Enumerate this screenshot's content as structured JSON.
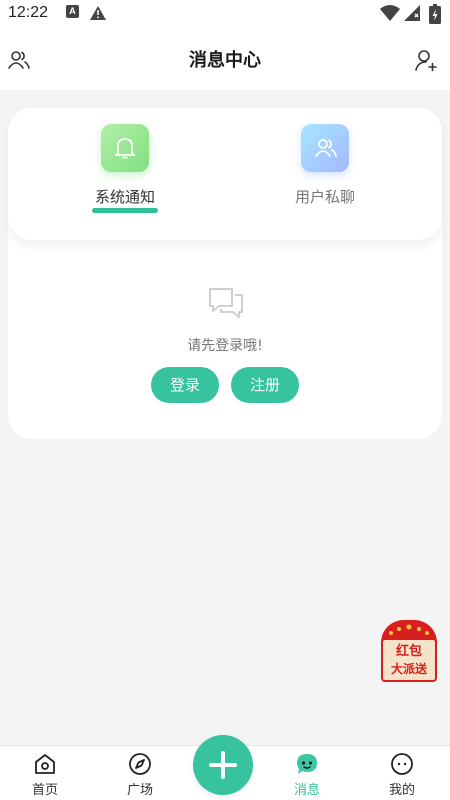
{
  "status_bar": {
    "time": "12:22",
    "a_badge": "A"
  },
  "header": {
    "title": "消息中心"
  },
  "tabs": [
    {
      "label": "系统通知",
      "active": true
    },
    {
      "label": "用户私聊",
      "active": false
    }
  ],
  "empty_state": {
    "text": "请先登录哦!"
  },
  "buttons": {
    "login": "登录",
    "register": "注册"
  },
  "red_packet": {
    "line1": "红包",
    "line2": "大派送"
  },
  "bottom_nav": {
    "items": [
      {
        "label": "首页",
        "icon": "home-icon"
      },
      {
        "label": "广场",
        "icon": "compass-icon"
      },
      {
        "label": "消息",
        "icon": "message-icon",
        "active": true
      },
      {
        "label": "我的",
        "icon": "profile-icon"
      }
    ],
    "fab_icon": "plus-icon"
  },
  "colors": {
    "accent": "#2fc09b",
    "button": "#37c39f",
    "red_packet": "#d81e1e"
  }
}
